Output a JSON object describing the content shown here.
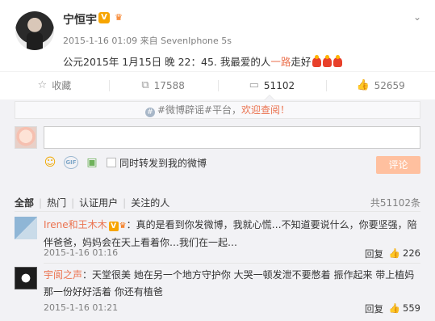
{
  "post": {
    "author": "宁恒宇",
    "verified_badge": "V",
    "timestamp": "2015-1-16 01:09",
    "source_prefix": "来自",
    "source": "SevenIphone 5s",
    "text_before": "公元2015年 1月15日 晚 22：45. 我最爱的人",
    "text_highlight": "一路",
    "text_after": "走好",
    "emoji_count": 3
  },
  "actions": {
    "favorite": "收藏",
    "repost_count": "17588",
    "comment_count": "51102",
    "like_count": "52659"
  },
  "comment_box": {
    "notice_hash": "#微博辟谣#平台，",
    "notice_link": "欢迎查阅！",
    "input_value": "",
    "input_placeholder": "",
    "repost_checkbox_label": "同时转发到我的微博",
    "submit_label": "评论"
  },
  "filters": {
    "items": [
      "全部",
      "热门",
      "认证用户",
      "关注的人"
    ],
    "active": "全部",
    "total": "共51102条"
  },
  "comments": [
    {
      "user": "Irene和王木木",
      "text": "：真的是看到你发微博，我就心慌…不知道要说什么，你要坚强，陪伴爸爸，妈妈会在天上看着你…我们在一起…",
      "time": "2015-1-16 01:16",
      "reply_label": "回复",
      "likes": "226",
      "has_badges": true
    },
    {
      "user": "宇阆之声",
      "text": "：天堂很美 她在另一个地方守护你 大哭一顿发泄不要憋着 振作起来 带上植妈那一份好好活着 你还有植爸",
      "time": "2015-1-16 01:21",
      "reply_label": "回复",
      "likes": "559",
      "has_badges": true
    }
  ],
  "colors": {
    "accent": "#eb7350",
    "verified": "#f7a500",
    "panel_bg": "#f2f2f5",
    "submit_bg": "#ffc09f"
  },
  "icons": [
    "chevron-down-icon",
    "star-icon",
    "repost-icon",
    "comment-icon",
    "thumb-up-icon",
    "emoji-icon",
    "gif-icon",
    "image-icon",
    "rumor-hash-icon"
  ]
}
